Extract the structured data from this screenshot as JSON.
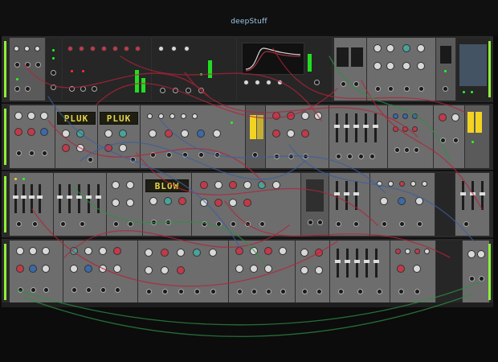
{
  "window": {
    "title": "deepStuff"
  },
  "rack": {
    "rows": [
      {
        "name": "row-1",
        "lcds": []
      },
      {
        "name": "row-2",
        "lcds": [
          "PLUK",
          "PLUK"
        ]
      },
      {
        "name": "row-3",
        "lcds": [
          "BLOW"
        ]
      },
      {
        "name": "row-4",
        "lcds": []
      }
    ]
  },
  "colors": {
    "background": "#0b0b0b",
    "rail": "#2a2a2a",
    "accent_green": "#8ef03a",
    "lcd_text": "#e7d34a",
    "cable_red": "#b3233a",
    "cable_blue": "#3b5f9e",
    "cable_green": "#2f8f44",
    "title_text": "#9ec8e8"
  }
}
